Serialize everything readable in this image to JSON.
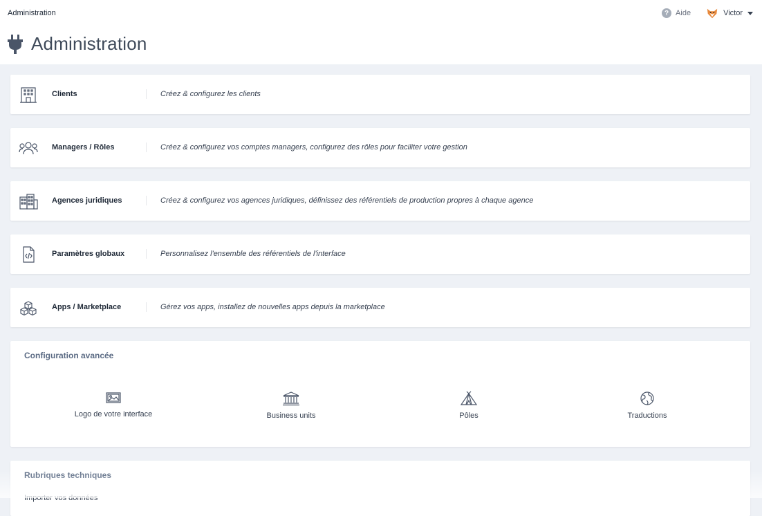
{
  "breadcrumb": "Administration",
  "header": {
    "title": "Administration",
    "help_label": "Aide",
    "user_name": "Victor"
  },
  "rows": [
    {
      "icon": "building-icon",
      "title": "Clients",
      "description": "Créez & configurez les clients"
    },
    {
      "icon": "users-icon",
      "title": "Managers / Rôles",
      "description": "Créez & configurez vos comptes managers, configurez des rôles pour faciliter votre gestion"
    },
    {
      "icon": "office-buildings-icon",
      "title": "Agences juridiques",
      "description": "Créez & configurez vos agences juridiques, définissez des référentiels de production propres à chaque agence"
    },
    {
      "icon": "code-file-icon",
      "title": "Paramètres globaux",
      "description": "Personnalisez l'ensemble des référentiels de l'interface"
    },
    {
      "icon": "boxes-icon",
      "title": "Apps / Marketplace",
      "description": "Gérez vos apps, installez de nouvelles apps depuis la marketplace"
    }
  ],
  "advanced": {
    "title": "Configuration avancée",
    "items": [
      {
        "icon": "image-icon",
        "label": "Logo de votre interface"
      },
      {
        "icon": "bank-icon",
        "label": "Business units"
      },
      {
        "icon": "tent-icon",
        "label": "Pôles"
      },
      {
        "icon": "globe-icon",
        "label": "Traductions"
      }
    ]
  },
  "technical": {
    "title": "Rubriques techniques",
    "first_link": "Importer vos données"
  },
  "colors": {
    "background": "#eef1f6",
    "card": "#ffffff",
    "icon": "#4a5568",
    "section_title": "#5b6b84"
  }
}
